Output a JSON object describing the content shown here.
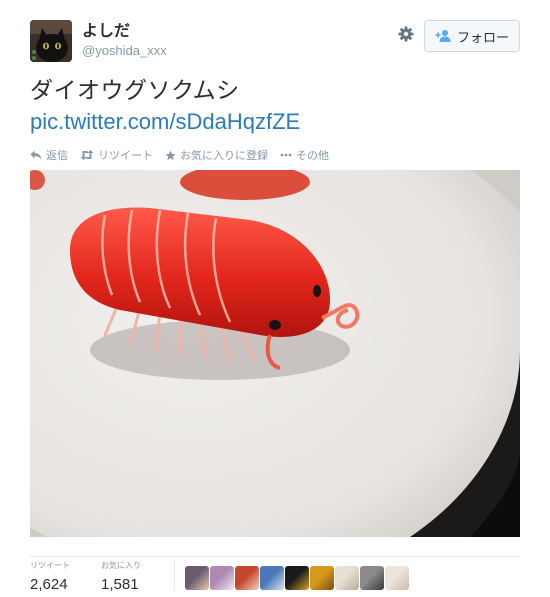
{
  "user": {
    "display_name": "よしだ",
    "screen_name": "@yoshida_xxx"
  },
  "follow_button": {
    "label": "フォロー"
  },
  "tweet": {
    "text": "ダイオウグソクムシ",
    "link": "pic.twitter.com/sDdaHqzfZE"
  },
  "actions": [
    {
      "label": "返信",
      "icon": "reply-icon"
    },
    {
      "label": "リツイート",
      "icon": "retweet-icon"
    },
    {
      "label": "お気に入りに登録",
      "icon": "star-icon"
    },
    {
      "label": "その他",
      "icon": "more-icon"
    }
  ],
  "stats": {
    "retweets": {
      "label": "リツイート",
      "value": "2,624"
    },
    "favorites": {
      "label": "お気に入り",
      "value": "1,581"
    }
  },
  "favoriters": [
    {
      "colors": [
        "#6b5a6e",
        "#e8c9a9"
      ]
    },
    {
      "colors": [
        "#b08ab5",
        "#f3e6ee"
      ]
    },
    {
      "colors": [
        "#c4462c",
        "#f1d2b8"
      ]
    },
    {
      "colors": [
        "#4a78b8",
        "#d8e2ef"
      ]
    },
    {
      "colors": [
        "#1a1a1a",
        "#d6a227"
      ]
    },
    {
      "colors": [
        "#d89a1c",
        "#7a4f12"
      ]
    },
    {
      "colors": [
        "#e6e0d2",
        "#b9ab95"
      ]
    },
    {
      "colors": [
        "#8a8a8a",
        "#3a3a3a"
      ]
    },
    {
      "colors": [
        "#ece6da",
        "#c9b9a6"
      ]
    }
  ],
  "colors": {
    "link": "#2b7bb9",
    "muted": "#8899a6",
    "text": "#292f33"
  }
}
